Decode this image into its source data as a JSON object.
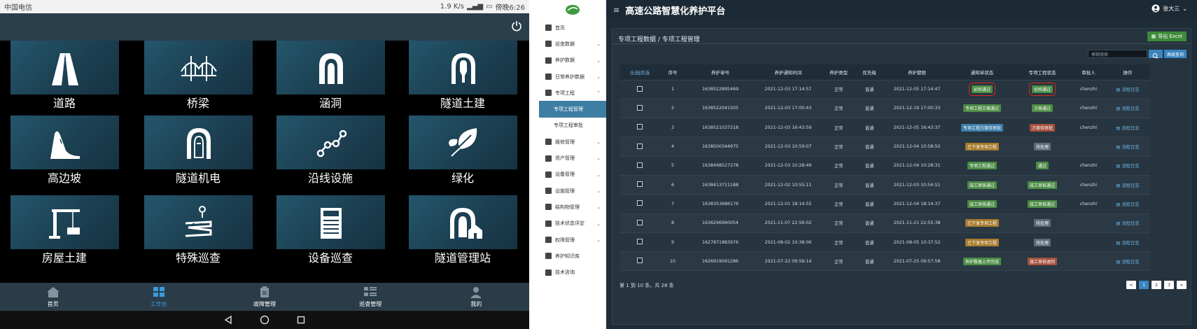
{
  "tablet": {
    "status": {
      "carrier": "中国电信",
      "speed": "1.9 K/s",
      "time": "傍晚6:26"
    },
    "tiles": [
      {
        "label": "道路",
        "icon": "road-icon"
      },
      {
        "label": "桥梁",
        "icon": "bridge-icon"
      },
      {
        "label": "涵洞",
        "icon": "culvert-icon"
      },
      {
        "label": "隧道土建",
        "icon": "tunnel-icon"
      },
      {
        "label": "高边坡",
        "icon": "slope-icon"
      },
      {
        "label": "隧道机电",
        "icon": "tunnel-electric-icon"
      },
      {
        "label": "沿线设施",
        "icon": "facility-icon"
      },
      {
        "label": "绿化",
        "icon": "leaf-icon"
      },
      {
        "label": "房屋土建",
        "icon": "crane-icon"
      },
      {
        "label": "特殊巡查",
        "icon": "special-inspection-icon"
      },
      {
        "label": "设备巡查",
        "icon": "device-icon"
      },
      {
        "label": "隧道管理站",
        "icon": "tunnel-station-icon"
      }
    ],
    "nav": [
      {
        "label": "首页",
        "icon": "home-icon"
      },
      {
        "label": "工作台",
        "icon": "workbench-icon",
        "active": true
      },
      {
        "label": "故障管理",
        "icon": "fault-icon"
      },
      {
        "label": "巡查管理",
        "icon": "inspection-icon"
      },
      {
        "label": "我的",
        "icon": "user-icon"
      }
    ]
  },
  "web": {
    "title": "高速公路智慧化养护平台",
    "user": "张大三",
    "breadcrumb": "专项工程数据 / 专项工程管理",
    "export_label": "导出 Excel",
    "search_placeholder": "模糊搜索",
    "adv_label": "高级查询",
    "sidebar": [
      {
        "label": "首页",
        "chev": ""
      },
      {
        "label": "巡查数据",
        "chev": "⌄"
      },
      {
        "label": "养护数据",
        "chev": "⌄"
      },
      {
        "label": "日常养护数据",
        "chev": "⌄"
      },
      {
        "label": "专项工程",
        "chev": "⌃"
      },
      {
        "label": "专项工程管理",
        "sub": true,
        "active": true
      },
      {
        "label": "专项工程审批",
        "sub": true
      },
      {
        "label": "报修管理",
        "chev": "⌄"
      },
      {
        "label": "资产管理",
        "chev": "⌄"
      },
      {
        "label": "设备管理",
        "chev": "⌄"
      },
      {
        "label": "设施管理",
        "chev": "⌄"
      },
      {
        "label": "结构物管理",
        "chev": "⌄"
      },
      {
        "label": "技术状态评定",
        "chev": "⌄"
      },
      {
        "label": "权限管理",
        "chev": "⌄"
      },
      {
        "label": "养护知识库",
        "chev": ""
      },
      {
        "label": "技术咨询",
        "chev": ""
      }
    ],
    "table": {
      "sel_all": "全选",
      "sel_sep": "|",
      "sel_inv": "反选",
      "headers": [
        "序号",
        "养护单号",
        "养护通知时间",
        "养护类型",
        "优先级",
        "养护期限",
        "通知单状态",
        "专项工程状态",
        "审批人",
        "操作"
      ],
      "rows": [
        {
          "no": "1",
          "id": "1638522895469",
          "notice": "2021-12-03 17:14:57",
          "type": "正常",
          "pri": "普通",
          "deadline": "2021-12-05 17:14:47",
          "status": "初验通过",
          "sc": "b-green",
          "proj": "初验通过",
          "pc": "b-green",
          "approver": "chenzhi",
          "op": "流程日志",
          "hl": true
        },
        {
          "no": "2",
          "id": "1638522041505",
          "notice": "2021-12-03 17:00:43",
          "type": "正常",
          "pri": "普通",
          "deadline": "2021-12-19 17:00:33",
          "status": "专项工程方案通过",
          "sc": "b-green",
          "proj": "方案通过",
          "pc": "b-green",
          "approver": "chenzhi",
          "op": "流程日志"
        },
        {
          "no": "3",
          "id": "1638521037218",
          "notice": "2021-12-03 16:43:59",
          "type": "正常",
          "pri": "普通",
          "deadline": "2021-12-05 16:43:37",
          "status": "专项工程方案待审批",
          "sc": "b-blue",
          "proj": "方案待审批",
          "pc": "b-red",
          "approver": "chenzhi",
          "op": "流程日志"
        },
        {
          "no": "4",
          "id": "1638500344975",
          "notice": "2021-12-03 10:59:07",
          "type": "正常",
          "pri": "普通",
          "deadline": "2021-12-04 10:58:50",
          "status": "已下发专项工程",
          "sc": "b-orange",
          "proj": "待处理",
          "pc": "b-gray",
          "approver": "",
          "op": "流程日志"
        },
        {
          "no": "5",
          "id": "1638498527278",
          "notice": "2021-12-03 10:28:49",
          "type": "正常",
          "pri": "普通",
          "deadline": "2021-12-04 10:28:31",
          "status": "专项工程通过",
          "sc": "b-green",
          "proj": "通过",
          "pc": "b-green",
          "approver": "chenzhi",
          "op": "流程日志"
        },
        {
          "no": "6",
          "id": "1638413711188",
          "notice": "2021-12-02 10:55:11",
          "type": "正常",
          "pri": "普通",
          "deadline": "2021-12-03 10:54:51",
          "status": "竣工审核通过",
          "sc": "b-green",
          "proj": "竣工审核通过",
          "pc": "b-green",
          "approver": "chenzhi",
          "op": "流程日志"
        },
        {
          "no": "7",
          "id": "1638353686176",
          "notice": "2021-12-01 18:14:55",
          "type": "正常",
          "pri": "普通",
          "deadline": "2021-12-04 18:14:37",
          "status": "竣工审核通过",
          "sc": "b-green",
          "proj": "竣工审核通过",
          "pc": "b-green",
          "approver": "chenzhi",
          "op": "流程日志"
        },
        {
          "no": "8",
          "id": "1636296960054",
          "notice": "2021-11-07 22:56:02",
          "type": "正常",
          "pri": "普通",
          "deadline": "2021-11-21 22:55:38",
          "status": "已下发专项工程",
          "sc": "b-orange",
          "proj": "待处理",
          "pc": "b-gray",
          "approver": "",
          "op": "流程日志"
        },
        {
          "no": "9",
          "id": "1627871883976",
          "notice": "2021-08-02 10:38:06",
          "type": "正常",
          "pri": "普通",
          "deadline": "2021-08-05 10:37:52",
          "status": "已下发专项工程",
          "sc": "b-orange",
          "proj": "待处理",
          "pc": "b-gray",
          "approver": "",
          "op": "流程日志"
        },
        {
          "no": "10",
          "id": "1626919091286",
          "notice": "2021-07-22 09:58:14",
          "type": "正常",
          "pri": "普通",
          "deadline": "2021-07-25 09:57:58",
          "status": "养护数据上传完成",
          "sc": "b-green",
          "proj": "施工审核退回",
          "pc": "b-red",
          "approver": "",
          "op": "流程日志"
        }
      ]
    },
    "footer": "第 1 到 10 条，共 28 条",
    "pages": [
      "<",
      "1",
      "2",
      "3",
      ">"
    ]
  }
}
